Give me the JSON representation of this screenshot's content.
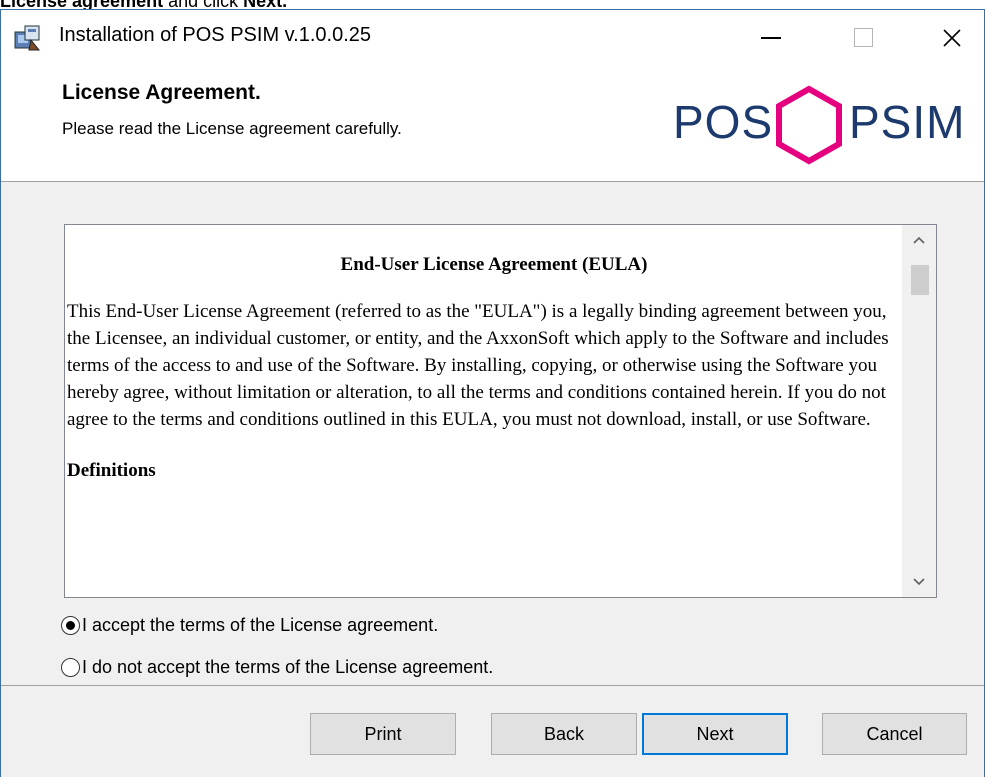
{
  "instruction": {
    "bold": "License agreement",
    "rest": " and click ",
    "bold2": "Next."
  },
  "window": {
    "title": "Installation of POS PSIM v.1.0.0.25",
    "icon": "installer-icon"
  },
  "header": {
    "title": "License Agreement.",
    "subtitle": "Please read the License agreement carefully.",
    "logo_left": "POS",
    "logo_right": "PSIM",
    "logo_text_color": "#1d3a6e",
    "logo_accent_color": "#e4007f"
  },
  "eula": {
    "heading": "End-User License Agreement (EULA)",
    "paragraph": "This End-User License Agreement (referred to as the \"EULA\") is a legally binding agreement between you, the Licensee, an individual customer, or entity, and the AxxonSoft which apply to the Software and includes terms of the access to and use of the Software. By installing, copying, or otherwise using the Software you hereby agree, without limitation or alteration, to all the terms and conditions contained herein. If you do not agree to the terms and conditions outlined in this EULA, you must not download, install, or use Software.",
    "section": "Definitions"
  },
  "options": {
    "accept": "I accept the terms of the License agreement.",
    "decline": "I do not accept the terms of the License agreement.",
    "selected": "accept"
  },
  "buttons": {
    "print": "Print",
    "back": "Back",
    "next": "Next",
    "cancel": "Cancel"
  },
  "colors": {
    "focus_border": "#0078d7",
    "window_border": "#3b6ea5"
  }
}
